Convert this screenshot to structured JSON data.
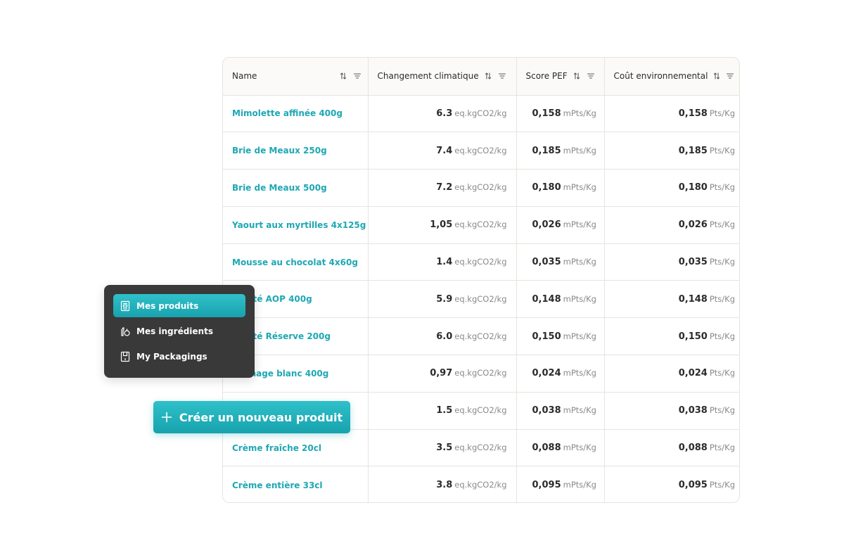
{
  "table": {
    "columns": [
      {
        "label": "Name"
      },
      {
        "label": "Changement climatique"
      },
      {
        "label": "Score PEF"
      },
      {
        "label": "Coût environnemental"
      }
    ],
    "rows": [
      {
        "name": "Mimolette affinée 400g",
        "climate": "6.3",
        "climate_unit": "eq.kgCO2/kg",
        "pef": "0,158",
        "pef_unit": "mPts/Kg",
        "cost": "0,158",
        "cost_unit": "Pts/Kg"
      },
      {
        "name": "Brie de Meaux 250g",
        "climate": "7.4",
        "climate_unit": "eq.kgCO2/kg",
        "pef": "0,185",
        "pef_unit": "mPts/Kg",
        "cost": "0,185",
        "cost_unit": "Pts/Kg"
      },
      {
        "name": "Brie de Meaux 500g",
        "climate": "7.2",
        "climate_unit": "eq.kgCO2/kg",
        "pef": "0,180",
        "pef_unit": "mPts/Kg",
        "cost": "0,180",
        "cost_unit": "Pts/Kg"
      },
      {
        "name": "Yaourt aux myrtilles 4x125g",
        "climate": "1,05",
        "climate_unit": "eq.kgCO2/kg",
        "pef": "0,026",
        "pef_unit": "mPts/Kg",
        "cost": "0,026",
        "cost_unit": "Pts/Kg"
      },
      {
        "name": "Mousse au chocolat 4x60g",
        "climate": "1.4",
        "climate_unit": "eq.kgCO2/kg",
        "pef": "0,035",
        "pef_unit": "mPts/Kg",
        "cost": "0,035",
        "cost_unit": "Pts/Kg"
      },
      {
        "name": "Comté AOP 400g",
        "climate": "5.9",
        "climate_unit": "eq.kgCO2/kg",
        "pef": "0,148",
        "pef_unit": "mPts/Kg",
        "cost": "0,148",
        "cost_unit": "Pts/Kg"
      },
      {
        "name": "Comté Réserve 200g",
        "climate": "6.0",
        "climate_unit": "eq.kgCO2/kg",
        "pef": "0,150",
        "pef_unit": "mPts/Kg",
        "cost": "0,150",
        "cost_unit": "Pts/Kg"
      },
      {
        "name": "Fromage blanc 400g",
        "climate": "0,97",
        "climate_unit": "eq.kgCO2/kg",
        "pef": "0,024",
        "pef_unit": "mPts/Kg",
        "cost": "0,024",
        "cost_unit": "Pts/Kg"
      },
      {
        "name": "",
        "climate": "1.5",
        "climate_unit": "eq.kgCO2/kg",
        "pef": "0,038",
        "pef_unit": "mPts/Kg",
        "cost": "0,038",
        "cost_unit": "Pts/Kg"
      },
      {
        "name": "Crème fraîche 20cl",
        "climate": "3.5",
        "climate_unit": "eq.kgCO2/kg",
        "pef": "0,088",
        "pef_unit": "mPts/Kg",
        "cost": "0,088",
        "cost_unit": "Pts/Kg"
      },
      {
        "name": "Crème entière 33cl",
        "climate": "3.8",
        "climate_unit": "eq.kgCO2/kg",
        "pef": "0,095",
        "pef_unit": "mPts/Kg",
        "cost": "0,095",
        "cost_unit": "Pts/Kg"
      }
    ]
  },
  "nav": {
    "items": [
      {
        "label": "Mes produits",
        "icon": "product-box-icon",
        "active": true
      },
      {
        "label": "Mes ingrédients",
        "icon": "ingredients-icon",
        "active": false
      },
      {
        "label": "My Packagings",
        "icon": "packaging-icon",
        "active": false
      }
    ]
  },
  "create_button": {
    "label": "Créer un nouveau produit",
    "icon": "plus-icon"
  },
  "colors": {
    "accent": "#1ea8b3",
    "menu_bg": "#393939",
    "border": "#e6e4df"
  }
}
